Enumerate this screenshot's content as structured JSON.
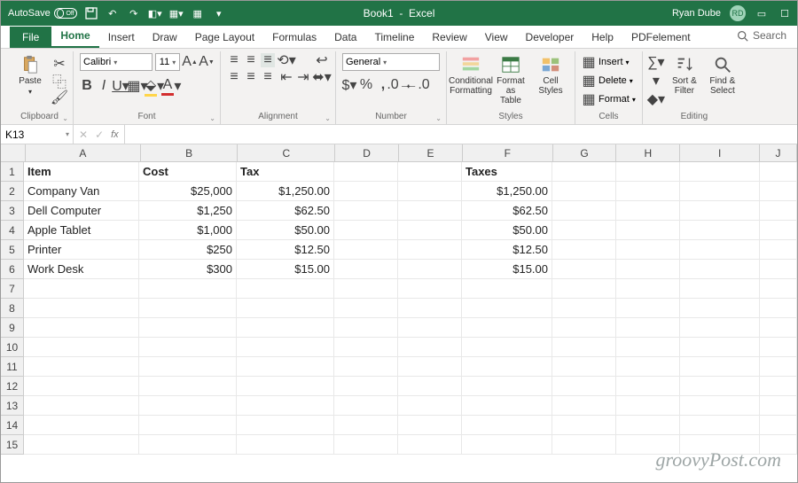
{
  "title": {
    "autosave": "AutoSave",
    "doc": "Book1",
    "app": "Excel",
    "user": "Ryan Dube",
    "initials": "RD"
  },
  "tabs": {
    "file": "File",
    "items": [
      "Home",
      "Insert",
      "Draw",
      "Page Layout",
      "Formulas",
      "Data",
      "Timeline",
      "Review",
      "View",
      "Developer",
      "Help",
      "PDFelement"
    ],
    "active": 0,
    "search": "Search"
  },
  "ribbon": {
    "clipboard": {
      "paste": "Paste",
      "label": "Clipboard"
    },
    "font": {
      "name": "Calibri",
      "size": "11",
      "label": "Font"
    },
    "alignment": {
      "label": "Alignment"
    },
    "number": {
      "format": "General",
      "label": "Number"
    },
    "styles": {
      "cond": "Conditional Formatting",
      "table": "Format as Table",
      "cell": "Cell Styles",
      "label": "Styles"
    },
    "cells": {
      "insert": "Insert",
      "delete": "Delete",
      "format": "Format",
      "label": "Cells"
    },
    "editing": {
      "sort": "Sort & Filter",
      "find": "Find & Select",
      "label": "Editing"
    }
  },
  "formula": {
    "namebox": "K13",
    "value": ""
  },
  "grid": {
    "columns": [
      "A",
      "B",
      "C",
      "D",
      "E",
      "F",
      "G",
      "H",
      "I",
      "J"
    ],
    "row_count": 15,
    "headers_row": {
      "A": "Item",
      "B": "Cost",
      "C": "Tax",
      "F": "Taxes"
    },
    "data": [
      {
        "A": "Company Van",
        "B": "$25,000",
        "C": "$1,250.00",
        "F": "$1,250.00"
      },
      {
        "A": "Dell Computer",
        "B": "$1,250",
        "C": "$62.50",
        "F": "$62.50"
      },
      {
        "A": "Apple Tablet",
        "B": "$1,000",
        "C": "$50.00",
        "F": "$50.00"
      },
      {
        "A": "Printer",
        "B": "$250",
        "C": "$12.50",
        "F": "$12.50"
      },
      {
        "A": "Work Desk",
        "B": "$300",
        "C": "$15.00",
        "F": "$15.00"
      }
    ],
    "selected": {
      "row": 13
    }
  },
  "watermark": "groovyPost.com"
}
